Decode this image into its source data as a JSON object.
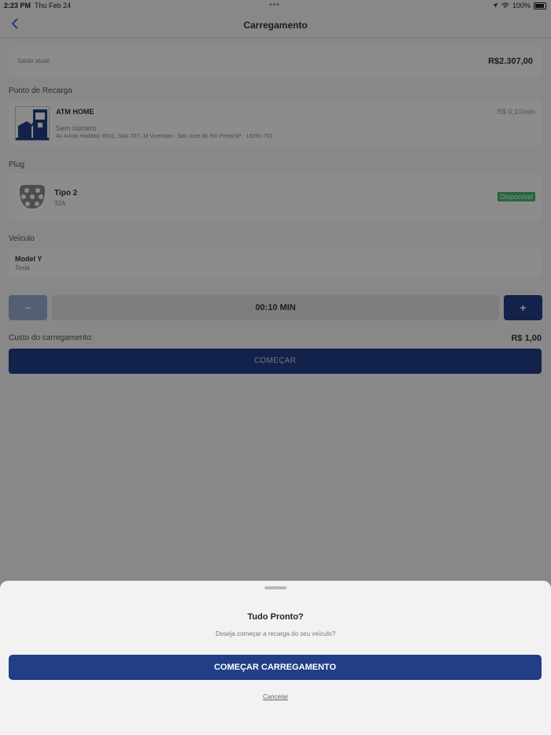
{
  "status_bar": {
    "time": "2:23 PM",
    "date": "Thu Feb 24",
    "multitask": "•••",
    "battery": "100%"
  },
  "nav": {
    "back_icon": "chevron-left",
    "title": "Carregamento"
  },
  "balance": {
    "label": "Saldo atual:",
    "value": "R$2.307,00"
  },
  "station": {
    "section_label": "Ponto de Recarga",
    "name": "ATM HOME",
    "price": "R$ 0,10/min",
    "number": "Sem número",
    "address": "Av Anisio Haddad, 8001, Sala 207, Jd Vivendas - Sao Jose do Rio Preto/SP - 15091-751"
  },
  "plug": {
    "section_label": "Plug",
    "type": "Tipo 2",
    "amperage": "32A",
    "status": "Disponível",
    "status_color": "#44b873"
  },
  "vehicle": {
    "section_label": "Veículo",
    "model": "Model Y",
    "brand": "Tesla"
  },
  "timer": {
    "minus_label": "−",
    "value": "00:10 MIN",
    "plus_label": "+"
  },
  "cost": {
    "label": "Custo do carregamento:",
    "value": "R$ 1,00"
  },
  "start_button": "COMEÇAR",
  "sheet": {
    "title": "Tudo Pronto?",
    "message": "Deseja começar a recarga do seu veículo?",
    "confirm": "COMEÇAR CARREGAMENTO",
    "cancel": "Cancelar"
  },
  "colors": {
    "primary": "#213e87",
    "accent_link": "#2a62c9"
  }
}
